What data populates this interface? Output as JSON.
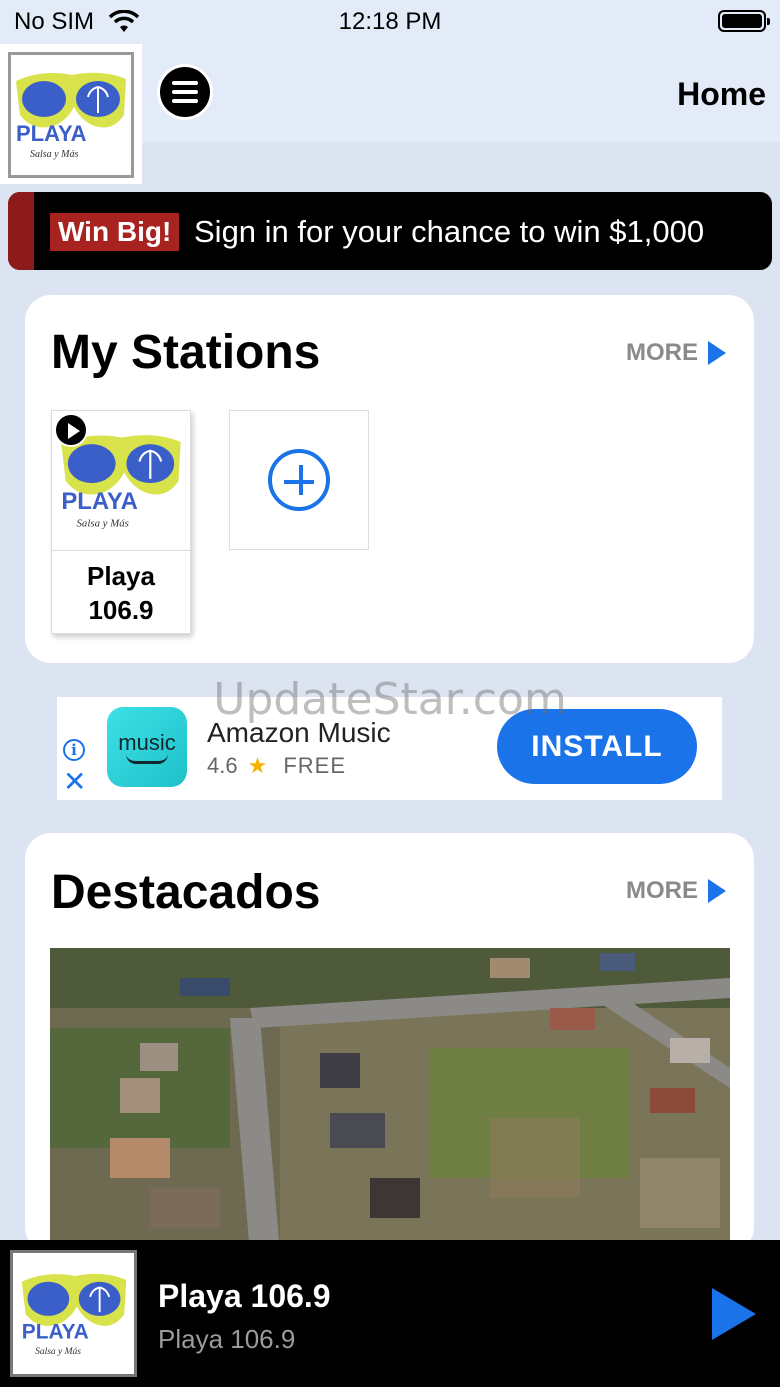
{
  "status_bar": {
    "carrier": "No SIM",
    "time": "12:18 PM"
  },
  "header": {
    "title": "Home",
    "logo_text": "106.9 PLAYA"
  },
  "promo": {
    "badge": "Win Big!",
    "text": "Sign in for your chance to win $1,000"
  },
  "my_stations": {
    "title": "My Stations",
    "more_label": "MORE",
    "stations": [
      {
        "name_line1": "Playa",
        "name_line2": "106.9"
      }
    ]
  },
  "ad": {
    "icon_text": "music",
    "app_name": "Amazon Music",
    "rating": "4.6",
    "price": "FREE",
    "install_label": "INSTALL",
    "info_symbol": "i",
    "close_symbol": "✕"
  },
  "watermark": "UpdateStar.com",
  "featured": {
    "title": "Destacados",
    "more_label": "MORE"
  },
  "player": {
    "title": "Playa 106.9",
    "subtitle": "Playa 106.9"
  },
  "colors": {
    "accent": "#1a73e8",
    "promo_red": "#a8231f",
    "background": "#dce4f1"
  }
}
